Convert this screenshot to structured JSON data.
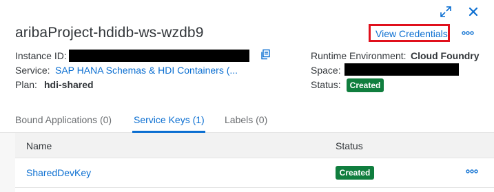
{
  "header": {
    "title": "aribaProject-hdidb-ws-wzdb9",
    "view_credentials_label": "View Credentials"
  },
  "details": {
    "instance_id_label": "Instance ID:",
    "service_label": "Service:",
    "service_value": "SAP HANA Schemas & HDI Containers (...",
    "plan_label": "Plan:",
    "plan_value": "hdi-shared",
    "runtime_label": "Runtime Environment:",
    "runtime_value": "Cloud Foundry",
    "space_label": "Space:",
    "status_label": "Status:",
    "status_value": "Created"
  },
  "tabs": [
    {
      "label": "Bound Applications (0)"
    },
    {
      "label": "Service Keys (1)"
    },
    {
      "label": "Labels (0)"
    }
  ],
  "table": {
    "columns": [
      "Name",
      "Status"
    ],
    "rows": [
      {
        "name": "SharedDevKey",
        "status": "Created"
      }
    ]
  },
  "icons": [
    "expand-icon",
    "close-icon",
    "copy-icon",
    "more-icon"
  ],
  "colors": {
    "accent": "#0a6ed1",
    "status_created": "#107e3e",
    "highlight_border": "#e0101c"
  }
}
